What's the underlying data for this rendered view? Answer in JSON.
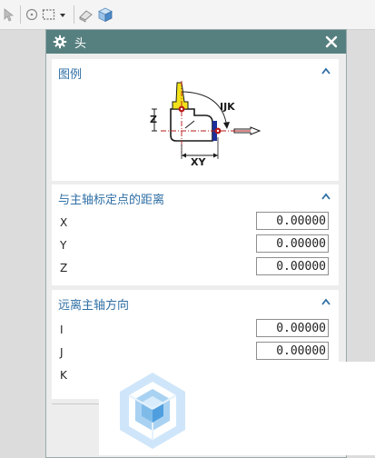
{
  "toolbar": {
    "icons": [
      "select-filter-icon",
      "circle-dot-icon",
      "rectangle-select-icon",
      "dropdown-arrow-icon",
      "eraser-icon",
      "cube-icon"
    ]
  },
  "dialog": {
    "title": "头",
    "title_icon": "gear-icon",
    "close_icon": "close-icon",
    "title_bg": "#56807f"
  },
  "legend_section": {
    "title": "图例",
    "diagram": {
      "labels": {
        "z": "Z",
        "xy": "XY",
        "ijk": "IJK"
      },
      "colors": {
        "tool": "#f2e21a",
        "head": "#1c2f9a",
        "arrow": "#b81818",
        "outline": "#1a1a1a"
      }
    }
  },
  "distance_section": {
    "title": "与主轴标定点的距离",
    "fields": [
      {
        "label": "X",
        "value": "0.00000"
      },
      {
        "label": "Y",
        "value": "0.00000"
      },
      {
        "label": "Z",
        "value": "0.00000"
      }
    ]
  },
  "direction_section": {
    "title": "远离主轴方向",
    "fields": [
      {
        "label": "I",
        "value": "0.00000"
      },
      {
        "label": "J",
        "value": "0.00000"
      },
      {
        "label": "K",
        "value": ""
      }
    ]
  },
  "accent_color": "#2f6fa5",
  "logo": "cube-logo-icon"
}
